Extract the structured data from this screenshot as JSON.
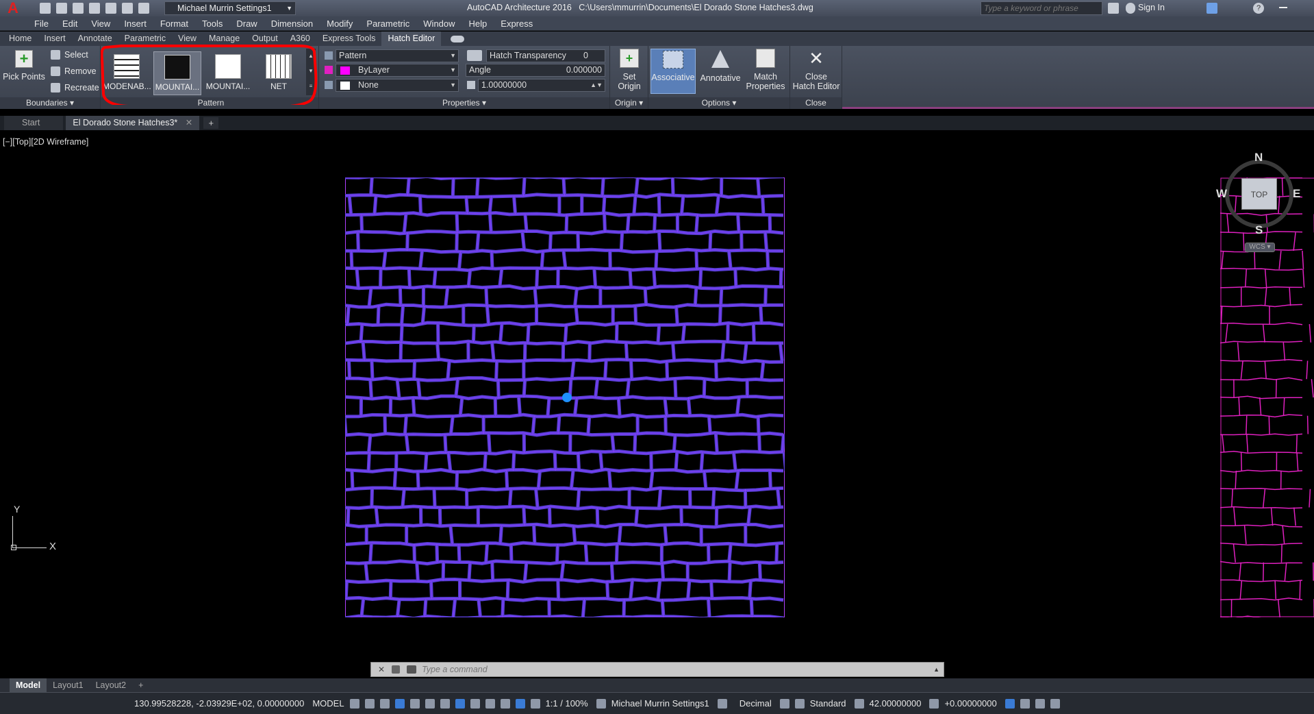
{
  "titlebar": {
    "app_title": "AutoCAD Architecture 2016",
    "file_path": "C:\\Users\\mmurrin\\Documents\\El Dorado Stone Hatches3.dwg",
    "workspace": "Michael Murrin Settings1",
    "search_placeholder": "Type a keyword or phrase",
    "sign_in": "Sign In"
  },
  "menubar": [
    "File",
    "Edit",
    "View",
    "Insert",
    "Format",
    "Tools",
    "Draw",
    "Dimension",
    "Modify",
    "Parametric",
    "Window",
    "Help",
    "Express"
  ],
  "ribbon_tabs": [
    "Home",
    "Insert",
    "Annotate",
    "Parametric",
    "View",
    "Manage",
    "Output",
    "A360",
    "Express Tools",
    "Hatch Editor"
  ],
  "ribbon": {
    "boundaries": {
      "pick_points": "Pick Points",
      "select": "Select",
      "remove": "Remove",
      "recreate": "Recreate",
      "title": "Boundaries"
    },
    "pattern": {
      "items": [
        "MODENAB...",
        "MOUNTAI...",
        "MOUNTAI...",
        "NET"
      ],
      "title": "Pattern"
    },
    "properties": {
      "type": "Pattern",
      "color": "ByLayer",
      "background": "None",
      "transparency_label": "Hatch Transparency",
      "transparency_value": "0",
      "angle_label": "Angle",
      "angle_value": "0.000000",
      "scale_value": "1.00000000",
      "title": "Properties"
    },
    "origin": {
      "set_origin_1": "Set",
      "set_origin_2": "Origin",
      "title": "Origin"
    },
    "options": {
      "associative": "Associative",
      "annotative": "Annotative",
      "match_1": "Match",
      "match_2": "Properties",
      "title": "Options"
    },
    "close": {
      "close_1": "Close",
      "close_2": "Hatch Editor",
      "title": "Close"
    }
  },
  "doc_tabs": {
    "start": "Start",
    "active": "El Dorado Stone Hatches3*"
  },
  "viewport": {
    "label": "[−][Top][2D Wireframe]",
    "viewcube": {
      "n": "N",
      "s": "S",
      "e": "E",
      "w": "W",
      "top": "TOP",
      "wcs": "WCS"
    },
    "ucs_x": "X",
    "ucs_y": "Y"
  },
  "command": {
    "placeholder": "Type a command"
  },
  "layout_tabs": [
    "Model",
    "Layout1",
    "Layout2"
  ],
  "status": {
    "coords": "130.99528228, -2.03929E+02, 0.00000000",
    "model": "MODEL",
    "scale": "1:1 / 100%",
    "workspace": "Michael Murrin Settings1",
    "units": "Decimal",
    "annotation": "Standard",
    "elevation": "42.00000000",
    "offset": "+0.00000000"
  },
  "colors": {
    "hatch_stroke": "#8a3fff",
    "hatch_fill": "#5a3fd8",
    "highlight": "#ff0000",
    "side_hatch": "#e020c0",
    "accent": "#3a7bd5"
  }
}
